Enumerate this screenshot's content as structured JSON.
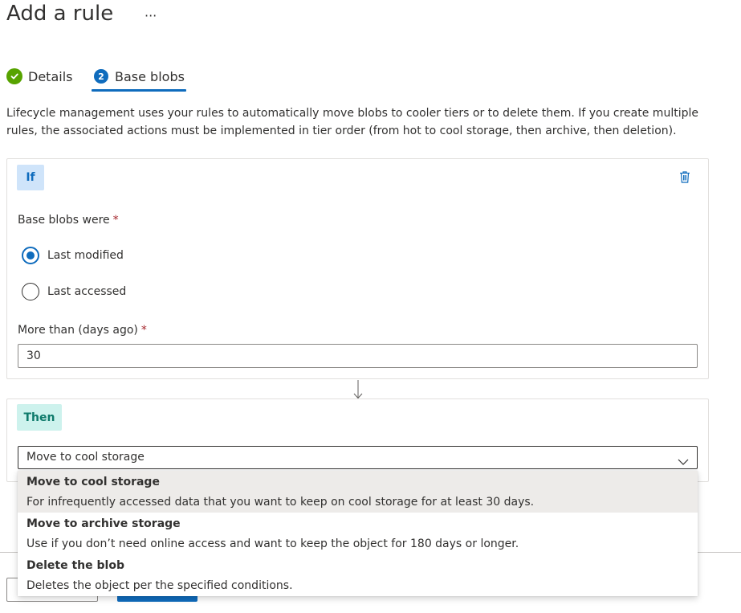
{
  "page": {
    "title": "Add a rule",
    "more_label": "···"
  },
  "tabs": [
    {
      "label": "Details",
      "state": "complete"
    },
    {
      "label": "Base blobs",
      "number": "2",
      "state": "active"
    }
  ],
  "description": "Lifecycle management uses your rules to automatically move blobs to cooler tiers or to delete them. If you create multiple rules, the associated actions must be implemented in tier order (from hot to cool storage, then archive, then deletion).",
  "if_block": {
    "chip": "If",
    "base_blobs_label": "Base blobs were",
    "required_mark": "*",
    "radio_options": [
      {
        "label": "Last modified",
        "selected": true
      },
      {
        "label": "Last accessed",
        "selected": false
      }
    ],
    "days_label": "More than (days ago)",
    "days_value": "30"
  },
  "then_block": {
    "chip": "Then",
    "selected_action": "Move to cool storage",
    "options": [
      {
        "title": "Move to cool storage",
        "description": "For infrequently accessed data that you want to keep on cool storage for at least 30 days.",
        "selected": true
      },
      {
        "title": "Move to archive storage",
        "description": "Use if you don’t need online access and want to keep the object for 180 days or longer.",
        "selected": false
      },
      {
        "title": "Delete the blob",
        "description": "Deletes the object per the specified conditions.",
        "selected": false
      }
    ]
  },
  "colors": {
    "accent": "#0f6cbd",
    "success": "#57a300",
    "if_chip_bg": "#cfe4fa",
    "then_chip_bg": "#cdf2ed",
    "required": "#a4262c"
  },
  "icons": {
    "tab_complete": "checkmark-icon",
    "delete": "trash-icon",
    "flow": "arrow-down-icon",
    "dropdown": "chevron-down-icon"
  }
}
